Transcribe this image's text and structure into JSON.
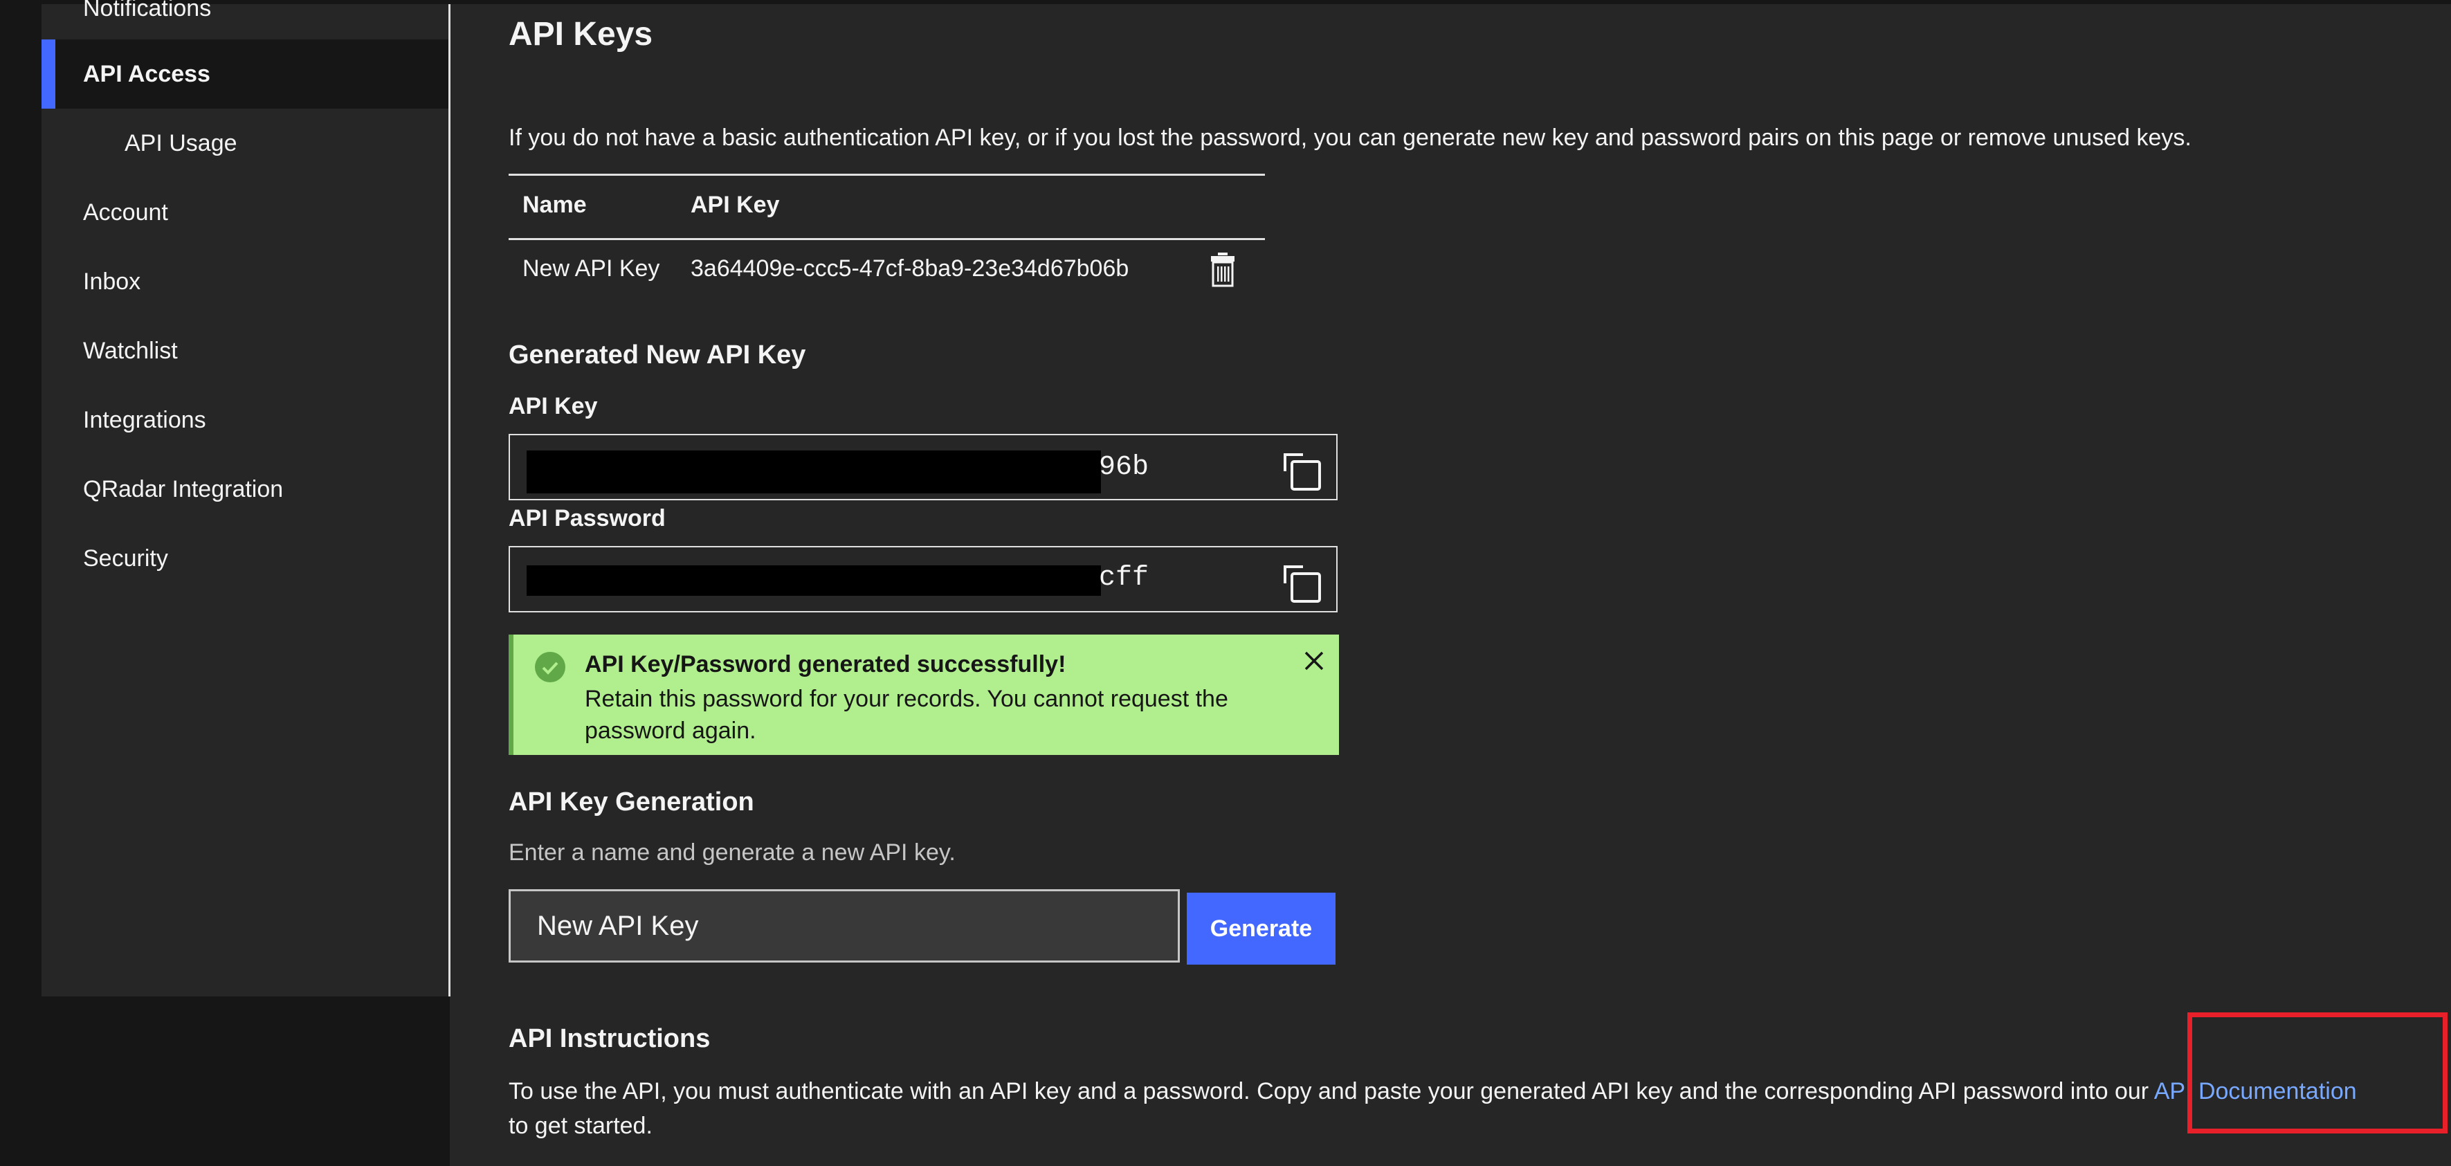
{
  "sidebar": {
    "items": [
      {
        "label": "Notifications",
        "active": false,
        "sub": false
      },
      {
        "label": "API Access",
        "active": true,
        "sub": false
      },
      {
        "label": "API Usage",
        "active": false,
        "sub": true
      },
      {
        "label": "Account",
        "active": false,
        "sub": false
      },
      {
        "label": "Inbox",
        "active": false,
        "sub": false
      },
      {
        "label": "Watchlist",
        "active": false,
        "sub": false
      },
      {
        "label": "Integrations",
        "active": false,
        "sub": false
      },
      {
        "label": "QRadar Integration",
        "active": false,
        "sub": false
      },
      {
        "label": "Security",
        "active": false,
        "sub": false
      }
    ]
  },
  "main": {
    "title": "API Keys",
    "description": "If you do not have a basic authentication API key, or if you lost the password, you can generate new key and password pairs on this page or remove unused keys.",
    "table": {
      "headers": [
        "Name",
        "API Key"
      ],
      "rows": [
        {
          "name": "New API Key",
          "api_key": "3a64409e-ccc5-47cf-8ba9-23e34d67b06b",
          "action_icon": "trash-icon"
        }
      ]
    },
    "generated": {
      "heading": "Generated New API Key",
      "api_key_label": "API Key",
      "api_key_visible_tail": "96b",
      "api_password_label": "API Password",
      "api_password_visible_tail": "cff",
      "copy_icon": "copy-icon"
    },
    "notification": {
      "title": "API Key/Password generated successfully!",
      "message": "Retain this password for your records. You cannot request the password again.",
      "status_icon": "checkmark-circle-icon",
      "close_icon": "close-icon"
    },
    "generation": {
      "heading": "API Key Generation",
      "description": "Enter a name and generate a new API key.",
      "name_input_value": "New API Key",
      "generate_label": "Generate"
    },
    "instructions": {
      "heading": "API Instructions",
      "text_before": "To use the API, you must authenticate with an API key and a password. Copy and paste your generated API key and the corresponding API password into our ",
      "link_label": "API Documentation",
      "text_after": " to get started."
    }
  },
  "colors": {
    "accent": "#4268ff",
    "link": "#78a9ff",
    "success_bg": "#b1ef8e",
    "success_border": "#61a849",
    "highlight": "#e8202a"
  }
}
